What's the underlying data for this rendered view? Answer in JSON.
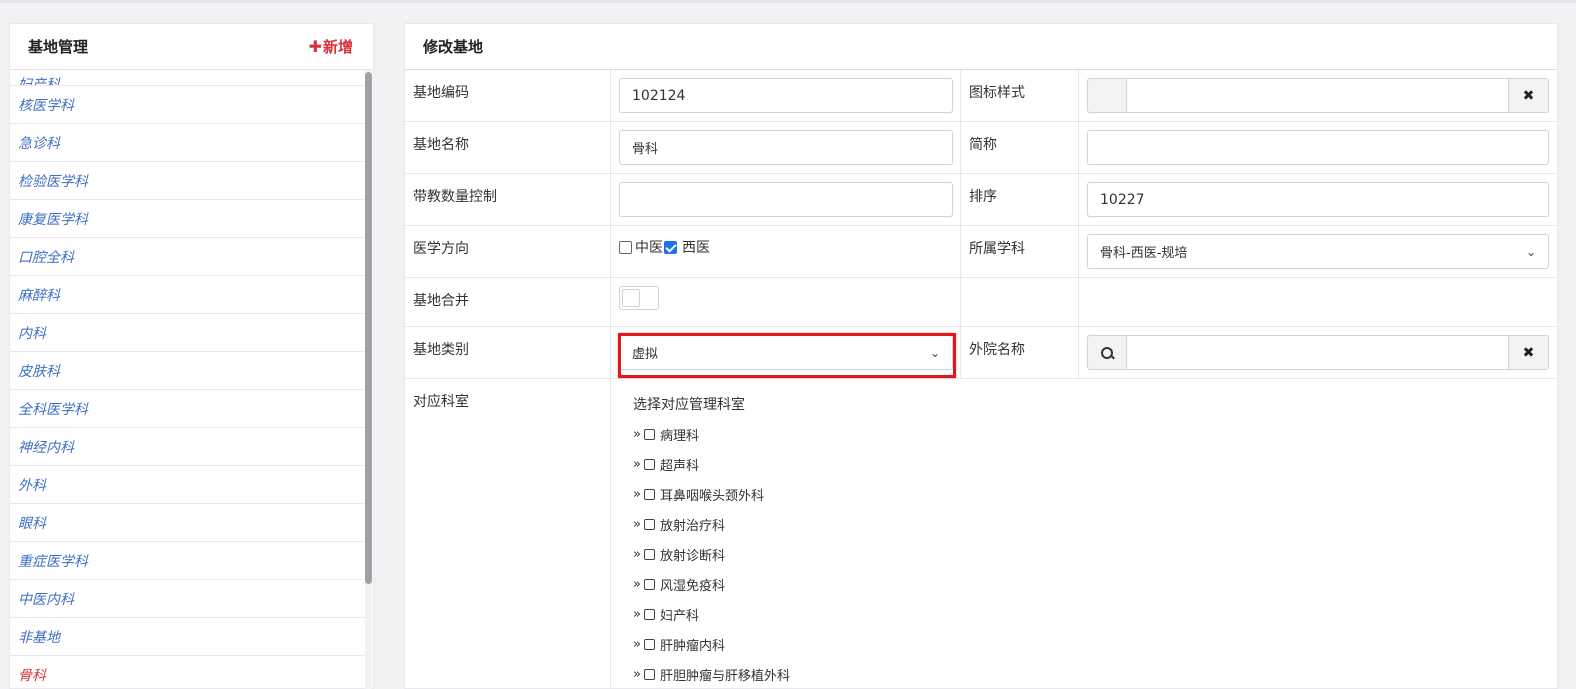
{
  "left": {
    "title": "基地管理",
    "add_label": "新增",
    "partial_item": "妇产科",
    "items": [
      "核医学科",
      "急诊科",
      "检验医学科",
      "康复医学科",
      "口腔全科",
      "麻醉科",
      "内科",
      "皮肤科",
      "全科医学科",
      "神经内科",
      "外科",
      "眼科",
      "重症医学科",
      "中医内科",
      "非基地",
      "骨科"
    ]
  },
  "right": {
    "title": "修改基地",
    "code_label": "基地编码",
    "code_value": "102124",
    "icon_style_label": "图标样式",
    "name_label": "基地名称",
    "name_value": "骨科",
    "short_label": "简称",
    "short_value": "",
    "teach_count_label": "带教数量控制",
    "teach_count_value": "",
    "order_label": "排序",
    "order_value": "10227",
    "direction_label": "医学方向",
    "direction_options": [
      "中医",
      "西医"
    ],
    "subject_label": "所属学科",
    "subject_value": "骨科-西医-规培",
    "merge_label": "基地合并",
    "category_label": "基地类别",
    "category_value": "虚拟",
    "external_label": "外院名称",
    "dept_label": "对应科室",
    "dept_title": "选择对应管理科室",
    "depts": [
      "病理科",
      "超声科",
      "耳鼻咽喉头颈外科",
      "放射治疗科",
      "放射诊断科",
      "风湿免疫科",
      "妇产科",
      "肝肿瘤内科",
      "肝胆肿瘤与肝移植外科"
    ]
  },
  "icons": {
    "add": "plus-icon",
    "clear": "close-icon",
    "search": "search-icon",
    "select": "chevron-down-icon",
    "expand": "double-chevron-right-icon"
  },
  "colors": {
    "accent_red": "#d7323c",
    "link_blue": "#3f6fc1",
    "checkbox_blue": "#1a73e8",
    "highlight": "#e0191e"
  }
}
